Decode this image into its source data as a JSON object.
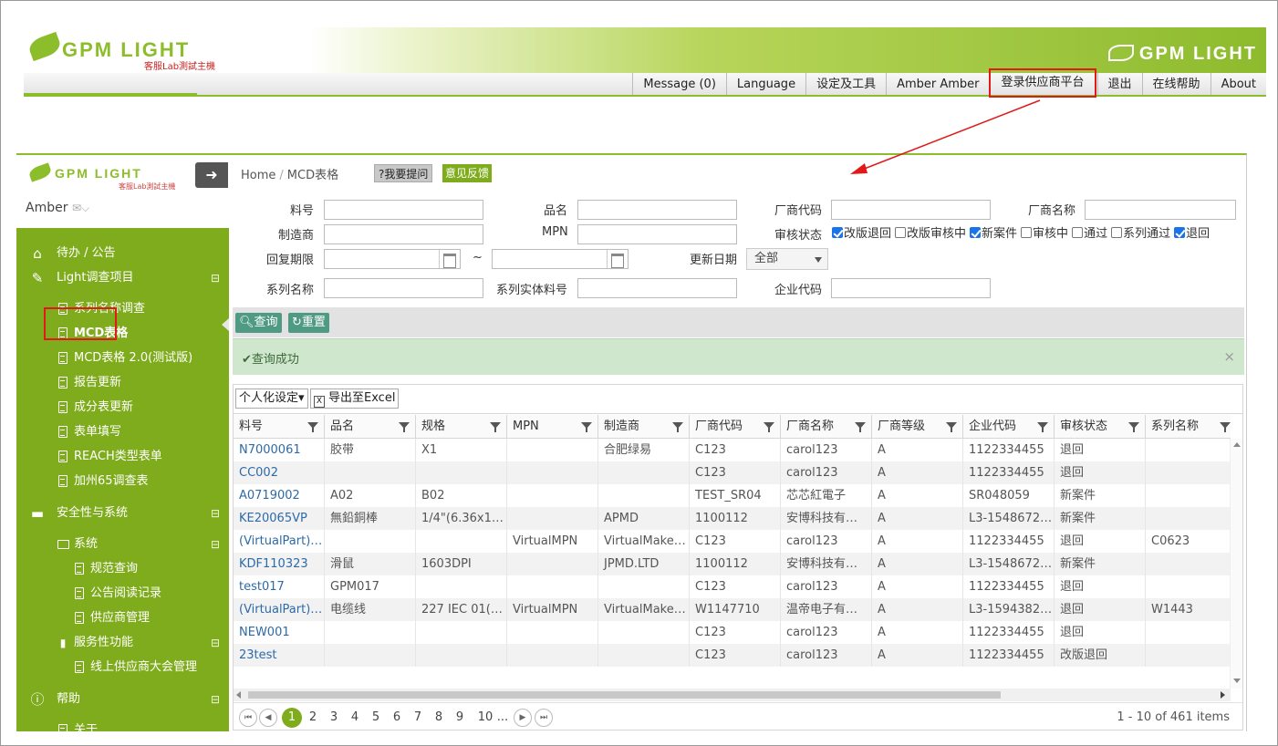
{
  "top": {
    "logo_text": "GPM LIGHT",
    "logo_sub": "客服Lab測試主機",
    "brand_text": "GPM LIGHT",
    "nav": [
      {
        "label": "Message (0)",
        "highlight": false
      },
      {
        "label": "Language",
        "highlight": false
      },
      {
        "label": "设定及工具",
        "highlight": false
      },
      {
        "label": "Amber Amber",
        "highlight": false
      },
      {
        "label": "登录供应商平台",
        "highlight": true
      },
      {
        "label": "退出",
        "highlight": false
      },
      {
        "label": "在线帮助",
        "highlight": false
      },
      {
        "label": "About",
        "highlight": false
      }
    ]
  },
  "sidebar": {
    "logo_text": "GPM LIGHT",
    "logo_sub": "客服Lab測試主機",
    "user": "Amber",
    "items": [
      {
        "label": "待办 / 公告",
        "level": 1,
        "icon": "home-icon",
        "toggle": ""
      },
      {
        "label": "Light调查项目",
        "level": 1,
        "icon": "edit-icon",
        "toggle": "⊟"
      },
      {
        "label": "系列名称调查",
        "level": 2,
        "icon": "document-icon",
        "toggle": ""
      },
      {
        "label": "MCD表格",
        "level": 2,
        "icon": "document-icon",
        "toggle": "",
        "active": true
      },
      {
        "label": "MCD表格 2.0(测试版)",
        "level": 2,
        "icon": "document-icon",
        "toggle": ""
      },
      {
        "label": "报告更新",
        "level": 2,
        "icon": "document-icon",
        "toggle": ""
      },
      {
        "label": "成分表更新",
        "level": 2,
        "icon": "document-icon",
        "toggle": ""
      },
      {
        "label": "表单填写",
        "level": 2,
        "icon": "document-icon",
        "toggle": ""
      },
      {
        "label": "REACH类型表单",
        "level": 2,
        "icon": "document-icon",
        "toggle": ""
      },
      {
        "label": "加州65调查表",
        "level": 2,
        "icon": "document-icon",
        "toggle": ""
      },
      {
        "label": "安全性与系统",
        "level": 1,
        "icon": "monitor-icon",
        "toggle": "⊟"
      },
      {
        "label": "系统",
        "level": 2,
        "icon": "folder-icon",
        "toggle": "⊟"
      },
      {
        "label": "规范查询",
        "level": 3,
        "icon": "document-icon",
        "toggle": ""
      },
      {
        "label": "公告阅读记录",
        "level": 3,
        "icon": "document-icon",
        "toggle": ""
      },
      {
        "label": "供应商管理",
        "level": 3,
        "icon": "document-icon",
        "toggle": ""
      },
      {
        "label": "服务性功能",
        "level": 2,
        "icon": "book-icon",
        "toggle": "⊟"
      },
      {
        "label": "线上供应商大会管理",
        "level": 3,
        "icon": "document-icon",
        "toggle": ""
      },
      {
        "label": "帮助",
        "level": 1,
        "icon": "info-icon",
        "toggle": "⊟"
      },
      {
        "label": "关于",
        "level": 2,
        "icon": "document-icon",
        "toggle": ""
      }
    ]
  },
  "main": {
    "breadcrumb": {
      "home": "Home",
      "sep": "/",
      "current": "MCD表格"
    },
    "ask_label": "?我要提问",
    "feedback_label": "意见反馈",
    "filters": {
      "part_no": "料号",
      "name": "品名",
      "vendor_code": "厂商代码",
      "vendor_name": "厂商名称",
      "manufacturer": "制造商",
      "mpn": "MPN",
      "review_status": "审核状态",
      "reply_deadline": "回复期限",
      "update_date": "更新日期",
      "update_date_value": "全部",
      "series_name": "系列名称",
      "series_entity_part": "系列实体料号",
      "company_code": "企业代码",
      "date_sep": "~"
    },
    "status_options": [
      {
        "label": "改版退回",
        "checked": true
      },
      {
        "label": "改版审核中",
        "checked": false
      },
      {
        "label": "新案件",
        "checked": true
      },
      {
        "label": "审核中",
        "checked": false
      },
      {
        "label": "通过",
        "checked": false
      },
      {
        "label": "系列通过",
        "checked": false
      },
      {
        "label": "退回",
        "checked": true
      }
    ],
    "query_label": "查询",
    "reset_label": "重置",
    "success_msg": "查询成功",
    "close_glyph": "×",
    "personalize_label": "个人化设定▾",
    "export_label": "导出至Excel"
  },
  "grid": {
    "columns": [
      "料号",
      "品名",
      "规格",
      "MPN",
      "制造商",
      "厂商代码",
      "厂商名称",
      "厂商等级",
      "企业代码",
      "审核状态",
      "系列名称"
    ],
    "rows": [
      [
        "N7000061",
        "胶带",
        "X1",
        "",
        "合肥绿易",
        "C123",
        "carol123",
        "A",
        "1122334455",
        "退回",
        ""
      ],
      [
        "CC002",
        "",
        "",
        "",
        "",
        "C123",
        "carol123",
        "A",
        "1122334455",
        "退回",
        ""
      ],
      [
        "A0719002",
        "A02",
        "B02",
        "",
        "",
        "TEST_SR04",
        "芯芯紅電子",
        "A",
        "SR048059",
        "新案件",
        ""
      ],
      [
        "KE20065VP",
        "無鉛銅棒",
        "1/4\"(6.36x1.…",
        "",
        "APMD",
        "1100112",
        "安博科技有…",
        "A",
        "L3-1548672…",
        "新案件",
        ""
      ],
      [
        "(VirtualPart)…",
        "",
        "",
        "VirtualMPN",
        "VirtualMaker…",
        "C123",
        "carol123",
        "A",
        "1122334455",
        "退回",
        "C0623"
      ],
      [
        "KDF110323",
        "滑鼠",
        "1603DPI",
        "",
        "JPMD.LTD",
        "1100112",
        "安博科技有…",
        "A",
        "L3-1548672…",
        "新案件",
        ""
      ],
      [
        "test017",
        "GPM017",
        "",
        "",
        "",
        "C123",
        "carol123",
        "A",
        "1122334455",
        "退回",
        ""
      ],
      [
        "(VirtualPart)…",
        "电缆线",
        "227 IEC 01(…",
        "VirtualMPN",
        "VirtualMaker…",
        "W1147710",
        "温帝电子有…",
        "A",
        "L3-1594382…",
        "退回",
        "W1443"
      ],
      [
        "NEW001",
        "",
        "",
        "",
        "",
        "C123",
        "carol123",
        "A",
        "1122334455",
        "退回",
        ""
      ],
      [
        "23test",
        "",
        "",
        "",
        "",
        "C123",
        "carol123",
        "A",
        "1122334455",
        "改版退回",
        ""
      ]
    ],
    "pager": {
      "pages": [
        "1",
        "2",
        "3",
        "4",
        "5",
        "6",
        "7",
        "8",
        "9",
        "10",
        "..."
      ],
      "current": "1",
      "info": "1 - 10 of 461 items"
    }
  },
  "colors": {
    "accent": "#7fac1d",
    "highlight": "#e01919",
    "link": "#2d6aa8",
    "button": "#4e9a82"
  }
}
